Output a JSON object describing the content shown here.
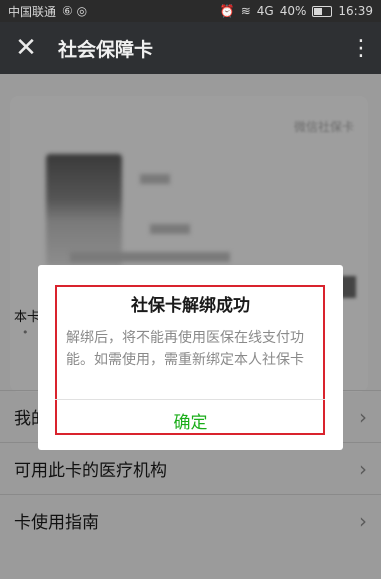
{
  "status_bar": {
    "carrier": "中国联通",
    "extra_icons": "⑥ ◎",
    "alarm_icon": "alarm-icon",
    "network": "4G",
    "battery": "40%",
    "time": "16:39"
  },
  "header": {
    "title": "社会保障卡"
  },
  "card": {
    "issuer": "微信社保卡",
    "note": "本卡",
    "note_dot": "•"
  },
  "list": [
    {
      "label": "我的"
    },
    {
      "label": "可用此卡的医疗机构"
    },
    {
      "label": "卡使用指南"
    }
  ],
  "dialog": {
    "title": "社保卡解绑成功",
    "message": "解绑后，将不能再使用医保在线支付功能。如需使用，需重新绑定本人社保卡",
    "confirm": "确定"
  },
  "colors": {
    "accent_green": "#1aad19",
    "highlight_red": "#d9232d",
    "topbar": "#2e3033"
  }
}
